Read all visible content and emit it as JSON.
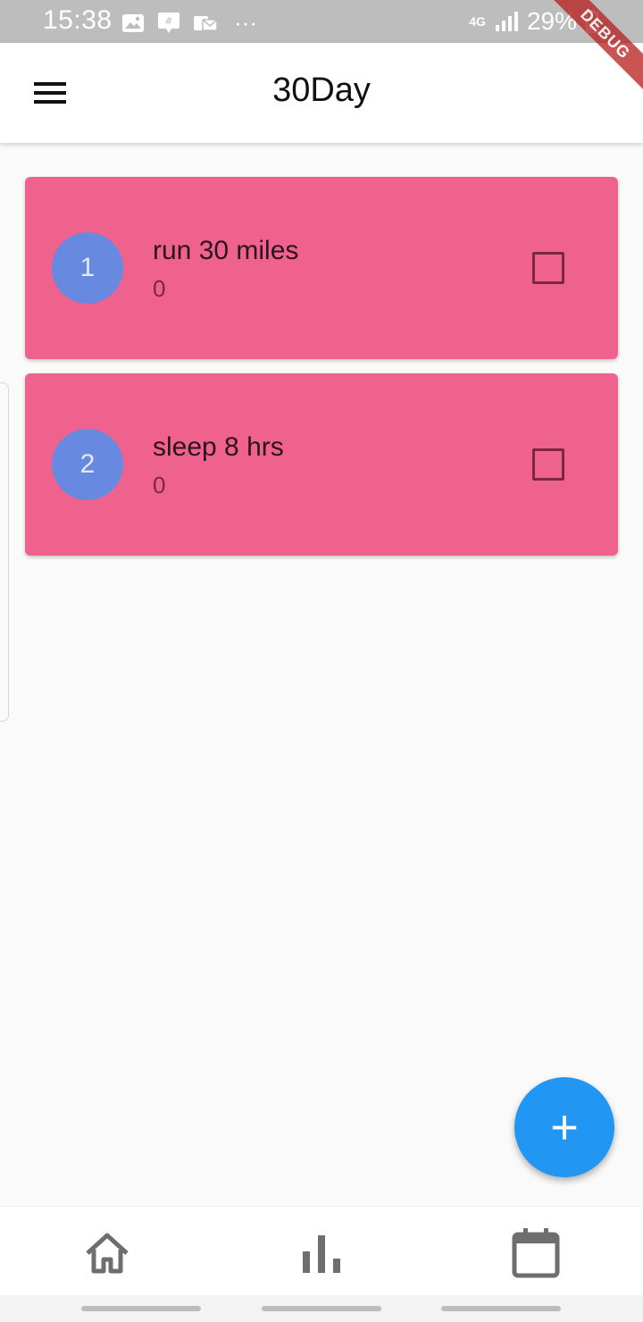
{
  "status_bar": {
    "time": "15:38",
    "network": "4G",
    "battery": "29%",
    "more": "···"
  },
  "debug_banner": "DEBUG",
  "app_bar": {
    "title": "30Day",
    "menu_icon": "hamburger-menu-icon"
  },
  "challenges": [
    {
      "index": "1",
      "title": "run 30 miles",
      "count": "0",
      "checked": false
    },
    {
      "index": "2",
      "title": "sleep 8 hrs",
      "count": "0",
      "checked": false
    }
  ],
  "fab": {
    "label": "+",
    "icon": "add-icon"
  },
  "bottom_nav": {
    "items": [
      {
        "name": "home",
        "icon": "home-icon"
      },
      {
        "name": "stats",
        "icon": "bar-chart-icon"
      },
      {
        "name": "calendar",
        "icon": "calendar-icon"
      }
    ]
  },
  "colors": {
    "card": "#f0628e",
    "avatar": "#6889e0",
    "fab": "#2196f3",
    "checkbox_border": "#7a2745"
  }
}
